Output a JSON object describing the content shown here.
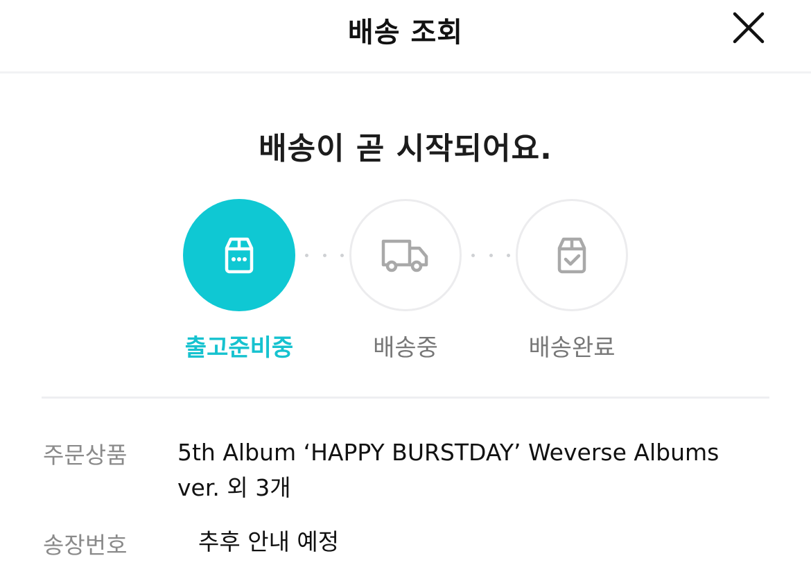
{
  "header": {
    "title": "배송 조회",
    "close_icon": "close-icon"
  },
  "status": {
    "headline": "배송이 곧 시작되어요."
  },
  "steps": [
    {
      "label": "출고준비중",
      "icon": "package-box-icon",
      "active": true
    },
    {
      "label": "배송중",
      "icon": "delivery-truck-icon",
      "active": false
    },
    {
      "label": "배송완료",
      "icon": "box-check-icon",
      "active": false
    }
  ],
  "colors": {
    "accent": "#0fc8d3",
    "accent_text": "#16c2cf",
    "inactive_icon": "#a9a9a9",
    "label_gray": "#8a8a8a"
  },
  "details": {
    "product_label": "주문상품",
    "product_value_line1": "5th Album ‘HAPPY BURSTDAY’ Weverse Albums",
    "product_value_line2": "ver. 외 3개",
    "tracking_label": "송장번호",
    "tracking_value": "추후 안내 예정"
  }
}
